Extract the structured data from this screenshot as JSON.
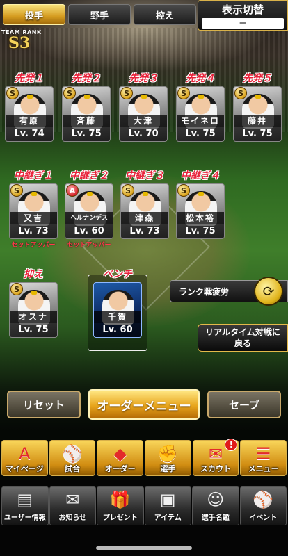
{
  "header": {
    "tabs": [
      {
        "label": "投手",
        "active": true
      },
      {
        "label": "野手",
        "active": false
      },
      {
        "label": "控え",
        "active": false
      }
    ],
    "display_switch": {
      "label": "表示切替",
      "value": "ー"
    },
    "team_rank": {
      "label": "TEAM RANK",
      "value": "S3"
    }
  },
  "starters": [
    {
      "slot": "先発１",
      "name": "有原",
      "level": "Lv. 74",
      "badge": "S"
    },
    {
      "slot": "先発２",
      "name": "斉藤",
      "level": "Lv. 75",
      "badge": "S"
    },
    {
      "slot": "先発３",
      "name": "大津",
      "level": "Lv. 70",
      "badge": "S"
    },
    {
      "slot": "先発４",
      "name": "モイネロ",
      "level": "Lv. 75",
      "badge": "S"
    },
    {
      "slot": "先発５",
      "name": "藤井",
      "level": "Lv. 75",
      "badge": "S"
    }
  ],
  "relievers": [
    {
      "slot": "中継ぎ１",
      "name": "又吉",
      "level": "Lv. 73",
      "badge": "S",
      "role": "セットアッパー"
    },
    {
      "slot": "中継ぎ２",
      "name": "ヘルナンデス",
      "level": "Lv. 60",
      "badge": "A",
      "role": "セットアッパー"
    },
    {
      "slot": "中継ぎ３",
      "name": "津森",
      "level": "Lv. 73",
      "badge": "S",
      "role": ""
    },
    {
      "slot": "中継ぎ４",
      "name": "松本裕",
      "level": "Lv. 75",
      "badge": "S",
      "role": ""
    }
  ],
  "closer": {
    "slot": "抑え",
    "name": "オスナ",
    "level": "Lv. 75",
    "badge": "S"
  },
  "bench": {
    "slot": "ベンチ",
    "name": "千賀",
    "level": "Lv. 60",
    "badge": ""
  },
  "side_buttons": {
    "fatigue": "ランク戦疲労",
    "realtime_line1": "リアルタイム対戦に",
    "realtime_line2": "戻る"
  },
  "actions": {
    "reset": "リセット",
    "order_menu": "オーダーメニュー",
    "save": "セーブ"
  },
  "main_nav": [
    {
      "label": "マイページ",
      "icon": "A"
    },
    {
      "label": "試合",
      "icon": "⚾"
    },
    {
      "label": "オーダー",
      "icon": "◆"
    },
    {
      "label": "選手",
      "icon": "✊"
    },
    {
      "label": "スカウト",
      "icon": "✉",
      "notify": "!"
    },
    {
      "label": "メニュー",
      "icon": "☰"
    }
  ],
  "sub_nav": [
    {
      "label": "ユーザー情報",
      "icon": "▤"
    },
    {
      "label": "お知らせ",
      "icon": "✉"
    },
    {
      "label": "プレゼント",
      "icon": "🎁"
    },
    {
      "label": "アイテム",
      "icon": "▣"
    },
    {
      "label": "選手名鑑",
      "icon": "☺"
    },
    {
      "label": "イベント",
      "icon": "⚾"
    }
  ],
  "colors": {
    "accent_gold": "#e7a41c",
    "slot_red": "#e8223a",
    "role_red": "#ff3a4a"
  }
}
